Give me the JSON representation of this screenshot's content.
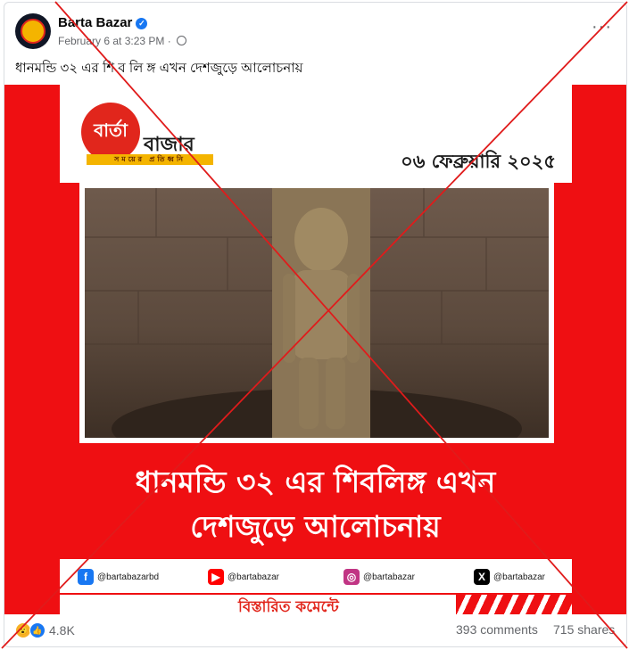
{
  "post": {
    "page_name": "Barta Bazar",
    "timestamp": "February 6 at 3:23 PM",
    "more_label": "···",
    "caption": "ধানমন্ডি ৩২ এর শি ব লি ঙ্গ এখন দেশজুড়ে আলোচনায়"
  },
  "media": {
    "logo_circle_text": "বার্তা",
    "logo_word": "বাজার",
    "logo_tagline": "সময়ের প্রতিধ্বনি",
    "date": "০৬ ফেব্রুয়ারি ২০২৫",
    "headline_line1": "ধানমন্ডি ৩২ এর শিবলিঙ্গ এখন",
    "headline_line2": "দেশজুড়ে আলোচনায়",
    "social": [
      {
        "icon": "facebook-icon",
        "glyph": "f",
        "color": "#1877f2",
        "handle": "@bartabazarbd"
      },
      {
        "icon": "youtube-icon",
        "glyph": "▶",
        "color": "#ff0000",
        "handle": "@bartabazar"
      },
      {
        "icon": "instagram-icon",
        "glyph": "◎",
        "color": "#c13584",
        "handle": "@bartabazar"
      },
      {
        "icon": "x-icon",
        "glyph": "X",
        "color": "#000000",
        "handle": "@bartabazar"
      }
    ],
    "cta": "বিস্তারিত কমেন্টে"
  },
  "stats": {
    "reaction_count": "4.8K",
    "comments": "393 comments",
    "shares": "715 shares"
  },
  "colors": {
    "brand_red": "#ef0f12",
    "overlay_cross": "#e01b1b",
    "link_blue": "#1877f2"
  }
}
